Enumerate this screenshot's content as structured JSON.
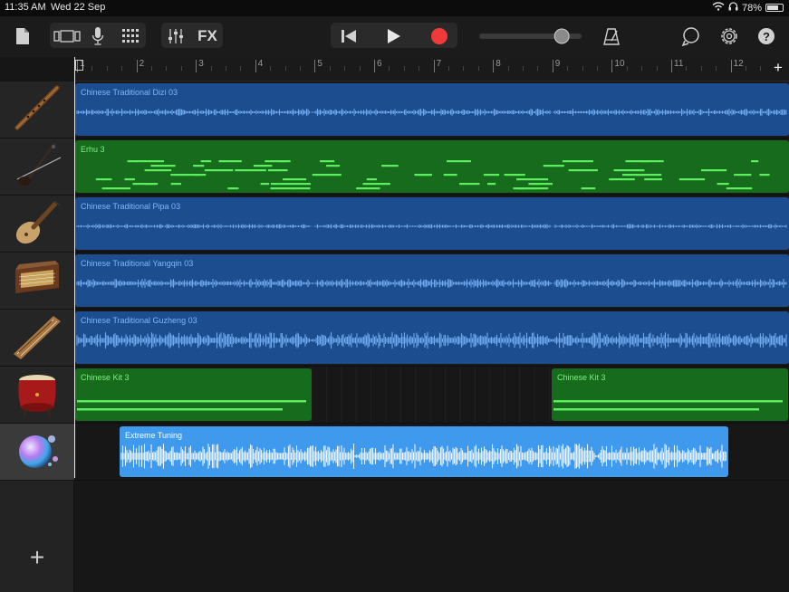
{
  "status": {
    "time": "11:35 AM",
    "date": "Wed 22 Sep",
    "battery": "78%",
    "battery_level": 0.78
  },
  "toolbar": {
    "fx_label": "FX",
    "icons": [
      "document-icon",
      "view-toggle-icon",
      "microphone-icon",
      "grid-icon",
      "mixer-icon",
      "rewind-icon",
      "play-icon",
      "record-icon",
      "volume-slider",
      "metronome-icon",
      "loop-icon",
      "settings-gear-icon",
      "help-icon"
    ],
    "volume_level": 0.85
  },
  "ruler": {
    "bars": [
      "1",
      "2",
      "3",
      "4",
      "5",
      "6",
      "7",
      "8",
      "9",
      "10",
      "11",
      "12"
    ],
    "add_label": "+"
  },
  "tracks": [
    {
      "instrument": "dizi",
      "regions": [
        {
          "name": "Chinese Traditional Dizi 03",
          "kind": "audio"
        }
      ]
    },
    {
      "instrument": "erhu",
      "regions": [
        {
          "name": "Erhu 3",
          "kind": "midi"
        }
      ]
    },
    {
      "instrument": "pipa",
      "regions": [
        {
          "name": "Chinese Traditional Pipa 03",
          "kind": "audio"
        }
      ]
    },
    {
      "instrument": "yangqin",
      "regions": [
        {
          "name": "Chinese Traditional Yangqin 03",
          "kind": "audio"
        }
      ]
    },
    {
      "instrument": "guzheng",
      "regions": [
        {
          "name": "Chinese Traditional Guzheng 03",
          "kind": "audio"
        }
      ]
    },
    {
      "instrument": "drum",
      "regions": [
        {
          "name": "Chinese Kit 3",
          "kind": "midi"
        },
        {
          "name": "Chinese Kit 3",
          "kind": "midi"
        }
      ]
    },
    {
      "instrument": "sampler-orb",
      "regions": [
        {
          "name": "Extreme Tuning",
          "kind": "audio-selected"
        }
      ]
    }
  ],
  "add_track_label": "+",
  "colors": {
    "audio_region": "#1c4d8f",
    "midi_region": "#176b1d",
    "selected_region": "#3f9aee",
    "record": "#f03a3a"
  }
}
